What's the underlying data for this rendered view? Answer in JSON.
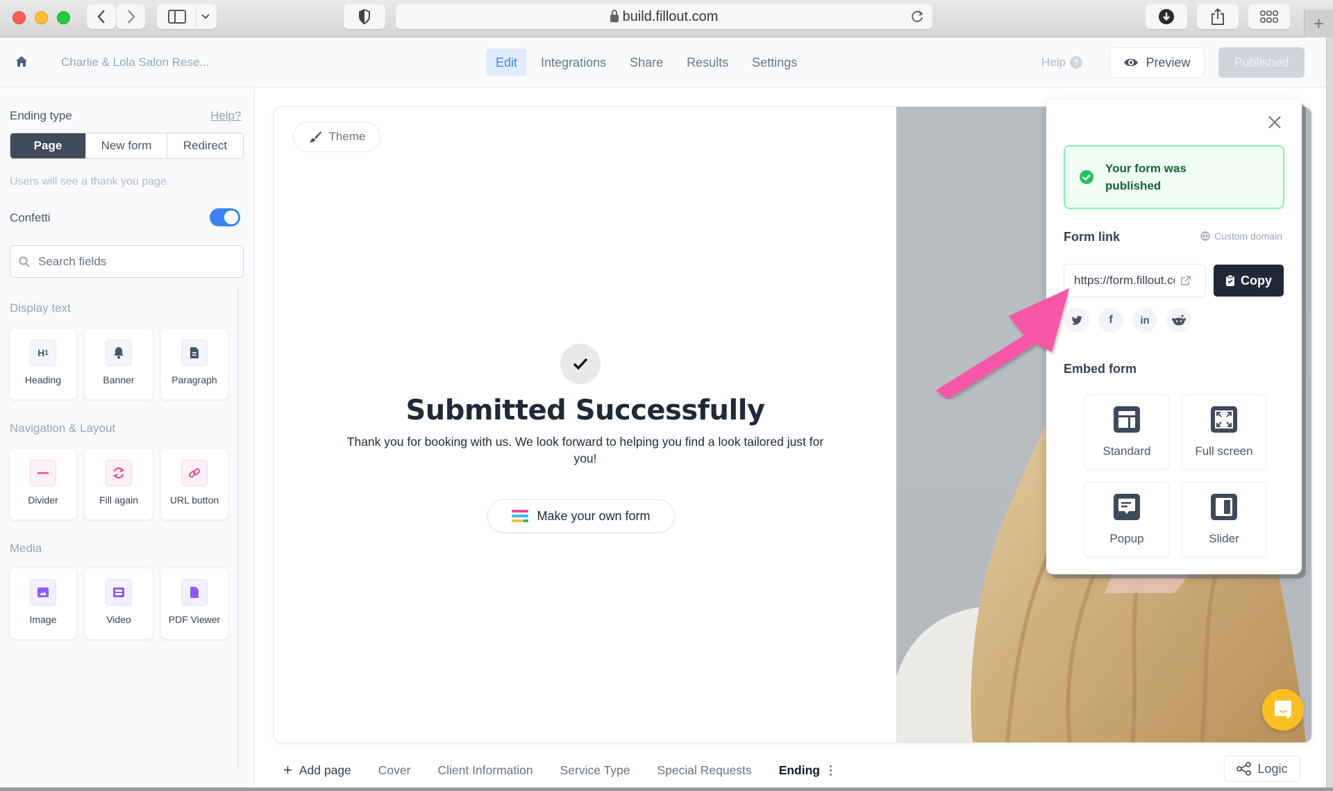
{
  "browser": {
    "url": "build.fillout.com",
    "buttons": [
      "back",
      "forward",
      "sidebar-toggle",
      "tab-overview",
      "privacy-shield",
      "reload",
      "downloads",
      "share",
      "tab-grid",
      "new-tab"
    ]
  },
  "header": {
    "form_title": "Charlie & Lola Salon Rese...",
    "nav": [
      {
        "label": "Edit",
        "active": true
      },
      {
        "label": "Integrations",
        "active": false
      },
      {
        "label": "Share",
        "active": false
      },
      {
        "label": "Results",
        "active": false
      },
      {
        "label": "Settings",
        "active": false
      }
    ],
    "help_label": "Help",
    "preview_label": "Preview",
    "published_label": "Published"
  },
  "sidebar": {
    "ending_type_label": "Ending type",
    "help_link": "Help?",
    "ending_types": [
      {
        "label": "Page",
        "active": true
      },
      {
        "label": "New form",
        "active": false
      },
      {
        "label": "Redirect",
        "active": false
      }
    ],
    "hint": "Users will see a thank you page.",
    "confetti_label": "Confetti",
    "confetti_on": true,
    "search_placeholder": "Search fields",
    "sections": [
      {
        "title": "Display text",
        "items": [
          {
            "label": "Heading",
            "icon": "heading-icon"
          },
          {
            "label": "Banner",
            "icon": "bell-icon"
          },
          {
            "label": "Paragraph",
            "icon": "document-icon"
          }
        ]
      },
      {
        "title": "Navigation & Layout",
        "items": [
          {
            "label": "Divider",
            "icon": "divider-icon"
          },
          {
            "label": "Fill again",
            "icon": "refresh-icon"
          },
          {
            "label": "URL button",
            "icon": "link-icon"
          }
        ]
      },
      {
        "title": "Media",
        "items": [
          {
            "label": "Image",
            "icon": "image-icon"
          },
          {
            "label": "Video",
            "icon": "video-icon"
          },
          {
            "label": "PDF Viewer",
            "icon": "pdf-icon"
          }
        ]
      }
    ]
  },
  "canvas": {
    "theme_label": "Theme",
    "ending_title": "Submitted Successfully",
    "ending_body": "Thank you for booking with us. We look forward to helping you find a look tailored just for you!",
    "make_form_label": "Make your own form"
  },
  "pages": {
    "add_label": "Add page",
    "tabs": [
      {
        "label": "Cover",
        "active": false
      },
      {
        "label": "Client Information",
        "active": false
      },
      {
        "label": "Service Type",
        "active": false
      },
      {
        "label": "Special Requests",
        "active": false
      },
      {
        "label": "Ending",
        "active": true
      }
    ],
    "logic_label": "Logic"
  },
  "share_popover": {
    "alert_text": "Your form was published",
    "form_link_label": "Form link",
    "custom_domain_label": "Custom domain",
    "form_link_value": "https://form.fillout.com",
    "copy_label": "Copy",
    "socials": [
      "twitter",
      "facebook",
      "linkedin",
      "reddit"
    ],
    "embed_label": "Embed form",
    "embed_options": [
      {
        "label": "Standard"
      },
      {
        "label": "Full screen"
      },
      {
        "label": "Popup"
      },
      {
        "label": "Slider"
      }
    ]
  },
  "colors": {
    "accent_blue": "#3b82f6",
    "annotation_pink": "#f857a6",
    "success_green": "#22c55e",
    "chat_yellow": "#fbbf24",
    "dark_button": "#1f2937"
  }
}
